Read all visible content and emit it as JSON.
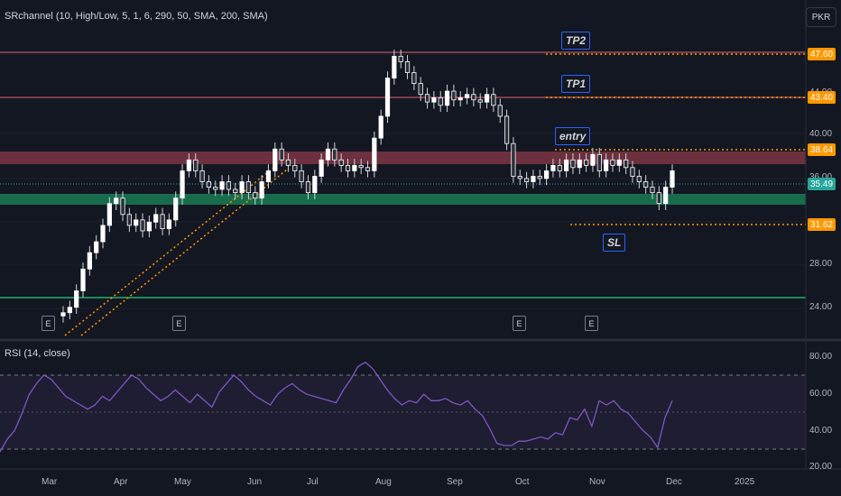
{
  "header": {
    "indicator": "SRchannel (10, High/Low, 5, 1, 6, 290, 50, SMA, 200, SMA)",
    "symbol_button": "PKR"
  },
  "rsi": {
    "label": "RSI (14, close)",
    "axis": [
      "80.00",
      "60.00",
      "40.00",
      "20.00"
    ],
    "levels": [
      70,
      50,
      30
    ]
  },
  "price_axis": [
    "47.60",
    "44.00",
    "40.00",
    "36.00",
    "32.00",
    "28.00",
    "24.00"
  ],
  "price_tags": {
    "tp2": "47.60",
    "tp1": "43.40",
    "entry": "38.64",
    "last": "35.49",
    "sl": "31.62"
  },
  "notes": {
    "tp2": "TP2",
    "tp1": "TP1",
    "entry": "entry",
    "sl": "SL"
  },
  "earnings_marker": "E",
  "x_axis": [
    "Mar",
    "Apr",
    "May",
    "Jun",
    "Jul",
    "Aug",
    "Sep",
    "Oct",
    "Nov",
    "Dec",
    "2025"
  ],
  "colors": {
    "background": "#131722",
    "up": "#ffffff",
    "down": "#ffffff",
    "support_zone": "#1b8a5a",
    "resistance_zone": "#8b3a4a",
    "tag_orange": "#ff9800",
    "rsi_line": "#7e57c2",
    "last_price": "#26a69a"
  },
  "chart_data": {
    "type": "candlestick",
    "series": [
      {
        "name": "price",
        "values": [
          22.5,
          23.0,
          24.5,
          26.5,
          28.0,
          29.0,
          30.5,
          32.5,
          33.0,
          31.5,
          30.5,
          31.0,
          30.0,
          30.8,
          31.5,
          30.2,
          31.0,
          33.0,
          35.5,
          36.5,
          35.5,
          34.5,
          34.0,
          33.8,
          34.5,
          33.8,
          33.5,
          34.5,
          33.5,
          33.0,
          34.5,
          35.5,
          37.5,
          36.5,
          36.0,
          35.5,
          34.5,
          33.5,
          35.0,
          36.5,
          37.5,
          36.5,
          36.0,
          35.5,
          36.0,
          35.8,
          35.5,
          38.5,
          40.5,
          44.0,
          46.0,
          45.5,
          44.5,
          43.5,
          42.5,
          41.8,
          42.2,
          41.5,
          42.8,
          42.0,
          42.2,
          42.5,
          42.0,
          41.8,
          42.5,
          41.5,
          40.5,
          38.0,
          35.0,
          34.8,
          34.5,
          35.0,
          34.8,
          35.5,
          36.0,
          35.5,
          36.5,
          35.8,
          36.5,
          36.0,
          37.0,
          35.5,
          36.5,
          36.0,
          36.5,
          35.8,
          35.0,
          34.5,
          34.0,
          33.5,
          32.5,
          34.0,
          35.5
        ]
      },
      {
        "name": "RSI (14, close)",
        "values": [
          28,
          34,
          38,
          46,
          55,
          60,
          64,
          62,
          58,
          54,
          52,
          50,
          48,
          50,
          54,
          52,
          56,
          60,
          64,
          62,
          58,
          55,
          52,
          54,
          57,
          54,
          51,
          55,
          52,
          49,
          56,
          60,
          64,
          61,
          57,
          54,
          52,
          50,
          55,
          58,
          60,
          57,
          55,
          54,
          53,
          52,
          51,
          57,
          62,
          68,
          70,
          67,
          62,
          57,
          53,
          50,
          52,
          51,
          55,
          52,
          52,
          53,
          51,
          50,
          52,
          48,
          45,
          39,
          32,
          31,
          31,
          33,
          33,
          34,
          35,
          34,
          37,
          36,
          44,
          43,
          48,
          40,
          52,
          50,
          52,
          48,
          46,
          42,
          38,
          35,
          30,
          44,
          52
        ]
      }
    ],
    "horizontal_levels": [
      47.6,
      43.4,
      38.64,
      31.62
    ],
    "zones": [
      {
        "from": 37.6,
        "to": 38.6
      },
      {
        "from": 33.7,
        "to": 34.6
      }
    ],
    "support_line": 24.8,
    "ylim": [
      20.0,
      49.5
    ],
    "rsi_ylim": [
      20,
      80
    ]
  }
}
